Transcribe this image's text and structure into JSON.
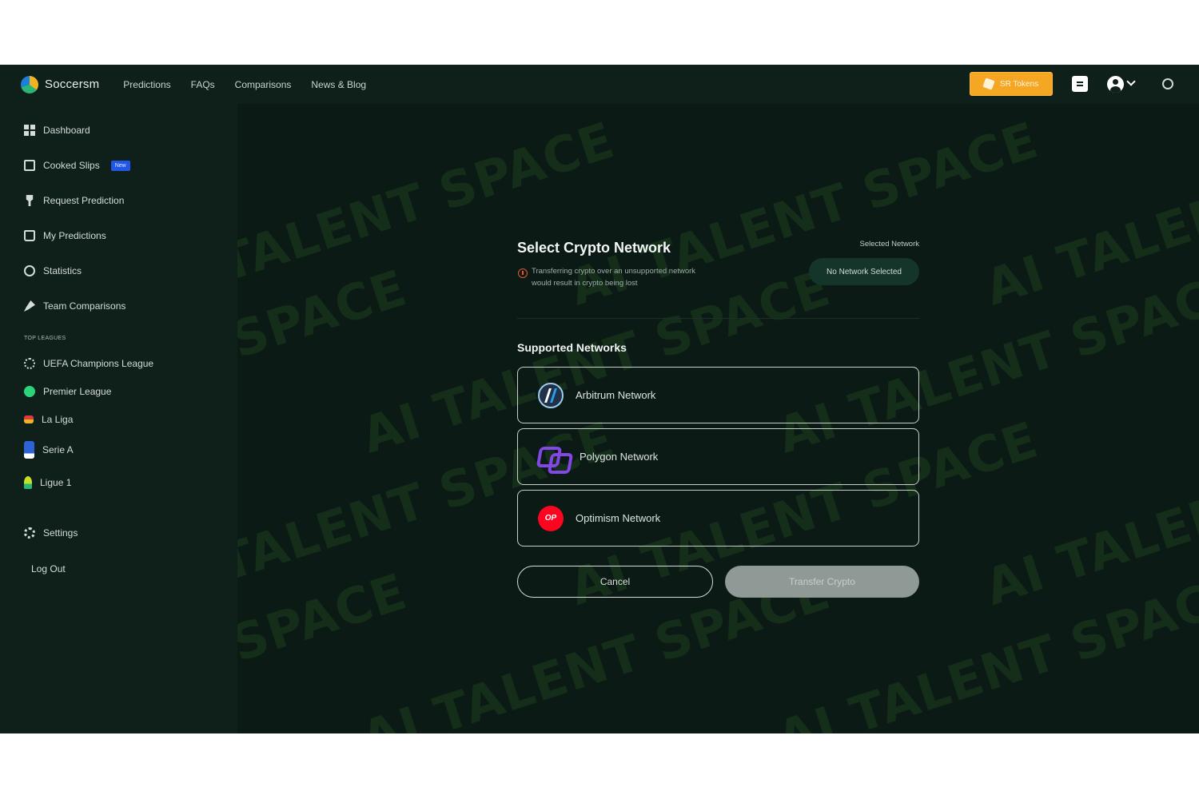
{
  "header": {
    "brand": "Soccersm",
    "nav": [
      "Predictions",
      "FAQs",
      "Comparisons",
      "News & Blog"
    ],
    "tokens_label": "SR Tokens"
  },
  "sidebar": {
    "items": [
      {
        "label": "Dashboard",
        "icon": "dashboard-icon"
      },
      {
        "label": "Cooked Slips",
        "icon": "slip-icon",
        "badge": "New"
      },
      {
        "label": "Request Prediction",
        "icon": "request-icon"
      },
      {
        "label": "My Predictions",
        "icon": "lock-icon"
      },
      {
        "label": "Statistics",
        "icon": "clock-icon"
      },
      {
        "label": "Team Comparisons",
        "icon": "compare-icon"
      }
    ],
    "section_label": "TOP LEAGUES",
    "leagues": [
      {
        "label": "UEFA Champions League",
        "icon": "ucl-icon"
      },
      {
        "label": "Premier League",
        "icon": "premier-league-icon"
      },
      {
        "label": "La Liga",
        "icon": "laliga-icon"
      },
      {
        "label": "Serie A",
        "icon": "serie-a-icon"
      },
      {
        "label": "Ligue 1",
        "icon": "ligue1-icon"
      }
    ],
    "settings": "Settings",
    "logout": "Log Out"
  },
  "modal": {
    "title": "Select Crypto Network",
    "warning": "Transferring crypto over an unsupported network would result in crypto being lost",
    "selected_label": "Selected Network",
    "selected_value": "No Network Selected",
    "supported_label": "Supported Networks",
    "networks": [
      {
        "label": "Arbitrum Network",
        "icon": "arbitrum-icon"
      },
      {
        "label": "Polygon Network",
        "icon": "polygon-icon"
      },
      {
        "label": "Optimism Network",
        "icon": "optimism-icon",
        "icon_text": "OP"
      }
    ],
    "cancel": "Cancel",
    "transfer": "Transfer Crypto"
  },
  "watermark": "AI TALENT SPACE",
  "colors": {
    "background": "#0c1a16",
    "sidebar": "#0f1f1a",
    "accent": "#f5a623",
    "optimism": "#ff0420",
    "polygon": "#8247e5"
  }
}
